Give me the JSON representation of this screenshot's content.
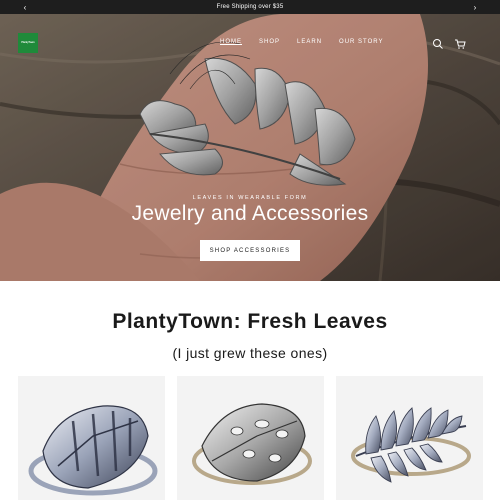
{
  "announcement": {
    "message": "Free Shipping over $35",
    "prev_icon": "chevron-left-icon",
    "next_icon": "chevron-right-icon"
  },
  "header": {
    "logo_text": "PlantyTown",
    "nav": [
      {
        "label": "HOME",
        "active": true
      },
      {
        "label": "SHOP",
        "active": false
      },
      {
        "label": "LEARN",
        "active": false
      },
      {
        "label": "OUR STORY",
        "active": false
      }
    ],
    "search_icon": "search-icon",
    "cart_icon": "cart-icon"
  },
  "hero": {
    "kicker": "LEAVES IN WEARABLE FORM",
    "title": "Jewelry and Accessories",
    "button_label": "SHOP ACCESSORIES",
    "slides": 4,
    "active_slide": 1
  },
  "section": {
    "title": "PlantyTown: Fresh Leaves",
    "subtitle": "(I just grew these ones)"
  },
  "products": [
    {
      "name_icon": "monstera-leaf-ring-image"
    },
    {
      "name_icon": "split-leaf-ring-image"
    },
    {
      "name_icon": "fern-leaf-ring-image"
    }
  ],
  "colors": {
    "announcement_bg": "#1e1e1e",
    "logo_green": "#1f8a3a",
    "card_bg": "#f3f3f3"
  }
}
